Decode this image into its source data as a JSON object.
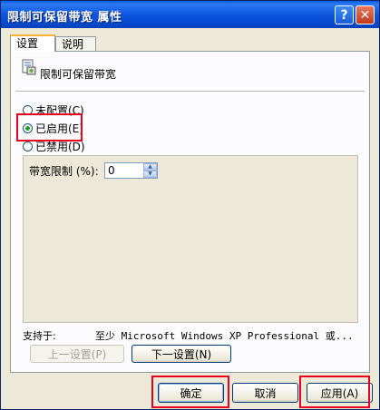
{
  "window": {
    "title": "限制可保留带宽 属性"
  },
  "titlebar": {
    "help_symbol": "?",
    "close_symbol": "✕"
  },
  "tabs": [
    {
      "label": "设置",
      "active": true
    },
    {
      "label": "说明",
      "active": false
    }
  ],
  "policy": {
    "name": "限制可保留带宽",
    "icon": "policy-setting-icon"
  },
  "radios": [
    {
      "label": "未配置(C)",
      "checked": false
    },
    {
      "label": "已启用(E)",
      "checked": true
    },
    {
      "label": "已禁用(D)",
      "checked": false
    }
  ],
  "options": {
    "bandwidth_label": "带宽限制 (%):",
    "bandwidth_value": "0",
    "spin_up": "▲",
    "spin_down": "▼"
  },
  "supported": {
    "label": "支持于:",
    "value": "至少 Microsoft Windows XP Professional 或..."
  },
  "nav_buttons": {
    "prev_label": "上一设置(P)",
    "next_label": "下一设置(N)"
  },
  "footer_buttons": {
    "ok_label": "确定",
    "cancel_label": "取消",
    "apply_label": "应用(A)"
  },
  "colors": {
    "highlight": "#e8001c",
    "titlebar": "#0a5ce0",
    "radio_checked": "#21a121"
  }
}
